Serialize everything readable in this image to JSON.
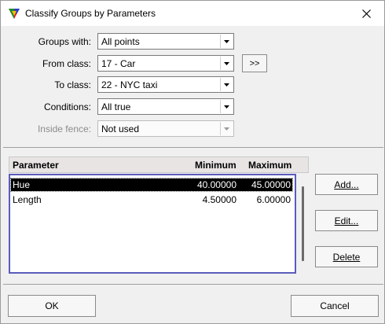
{
  "window": {
    "title": "Classify Groups by Parameters",
    "app_icon": "triangle-app-icon",
    "close_icon": "close-icon"
  },
  "form": {
    "groups_with": {
      "label": "Groups with:",
      "value": "All points"
    },
    "from_class": {
      "label": "From class:",
      "value": "17 - Car"
    },
    "to_class": {
      "label": "To class:",
      "value": "22 - NYC taxi"
    },
    "conditions": {
      "label": "Conditions:",
      "value": "All true"
    },
    "inside_fence": {
      "label": "Inside fence:",
      "value": "Not used",
      "disabled": true
    },
    "swap_button_label": ">>"
  },
  "parameters": {
    "columns": [
      "Parameter",
      "Minimum",
      "Maximum"
    ],
    "rows": [
      {
        "parameter": "Hue",
        "minimum": "40.00000",
        "maximum": "45.00000",
        "selected": true
      },
      {
        "parameter": "Length",
        "minimum": "4.50000",
        "maximum": "6.00000",
        "selected": false
      }
    ]
  },
  "side_buttons": {
    "add": "Add...",
    "edit": "Edit...",
    "delete": "Delete"
  },
  "bottom_buttons": {
    "ok": "OK",
    "cancel": "Cancel"
  }
}
